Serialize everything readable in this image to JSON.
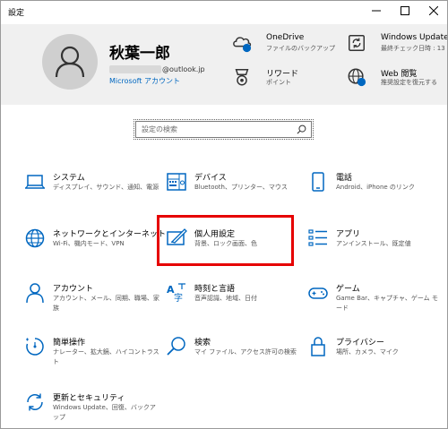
{
  "window": {
    "title": "設定"
  },
  "account": {
    "name": "秋葉一郎",
    "email_domain": "@outlook.jp",
    "account_type": "Microsoft アカウント"
  },
  "header_items": [
    {
      "label": "OneDrive",
      "sub": "ファイルのバックアップ",
      "icon": "onedrive-icon"
    },
    {
      "label": "Windows Update",
      "sub": "最終チェック日時 : 13 分前",
      "icon": "windows-update-icon"
    },
    {
      "label": "リワード",
      "sub": "ポイント",
      "icon": "rewards-icon"
    },
    {
      "label": "Web 閲覧",
      "sub": "推奨設定を復元する",
      "icon": "web-browsing-icon"
    }
  ],
  "search": {
    "placeholder": "設定の検索"
  },
  "categories": [
    {
      "label": "システム",
      "desc": "ディスプレイ、サウンド、通知、電源",
      "icon": "system-laptop-icon"
    },
    {
      "label": "デバイス",
      "desc": "Bluetooth、プリンター、マウス",
      "icon": "devices-keyboard-icon"
    },
    {
      "label": "電話",
      "desc": "Android、iPhone のリンク",
      "icon": "phone-icon"
    },
    {
      "label": "ネットワークとインターネット",
      "desc": "Wi-Fi、機内モード、VPN",
      "icon": "network-globe-icon"
    },
    {
      "label": "個人用設定",
      "desc": "背景、ロック画面、色",
      "icon": "personalization-icon"
    },
    {
      "label": "アプリ",
      "desc": "アンインストール、既定値",
      "icon": "apps-list-icon"
    },
    {
      "label": "アカウント",
      "desc": "アカウント、メール、同期、職場、家族",
      "icon": "accounts-person-icon"
    },
    {
      "label": "時刻と言語",
      "desc": "音声認識、地域、日付",
      "icon": "time-language-icon"
    },
    {
      "label": "ゲーム",
      "desc": "Game Bar、キャプチャ、ゲーム モード",
      "icon": "gaming-controller-icon"
    },
    {
      "label": "簡単操作",
      "desc": "ナレーター、拡大鏡、ハイコントラスト",
      "icon": "ease-of-access-icon"
    },
    {
      "label": "検索",
      "desc": "マイ ファイル、アクセス許可の検索",
      "icon": "search-magnifier-icon"
    },
    {
      "label": "プライバシー",
      "desc": "場所、カメラ、マイク",
      "icon": "privacy-lock-icon"
    },
    {
      "label": "更新とセキュリティ",
      "desc": "Windows Update、回復、バックアップ",
      "icon": "update-security-icon"
    }
  ],
  "colors": {
    "accent": "#0067c0",
    "highlight": "#e60000",
    "header_bg": "#f0f0f0"
  }
}
